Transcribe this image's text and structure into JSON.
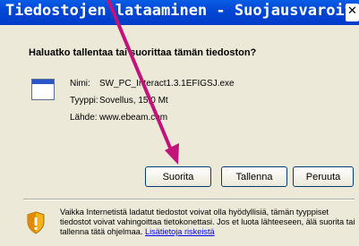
{
  "window": {
    "title": "Tiedostojen lataaminen - Suojausvaroitus"
  },
  "dialog": {
    "question": "Haluatko tallentaa tai suorittaa tämän tiedoston?",
    "fields": [
      {
        "label": "Nimi:",
        "value": "SW_PC_Interact1.3.1EFIGSJ.exe"
      },
      {
        "label": "Tyyppi:",
        "value": "Sovellus, 15,0 Mt"
      },
      {
        "label": "Lähde:",
        "value": "www.ebeam.com"
      }
    ],
    "buttons": {
      "run": "Suorita",
      "save": "Tallenna",
      "cancel": "Peruuta"
    },
    "warning_text": "Vaikka Internetistä ladatut tiedostot voivat olla hyödyllisiä, tämän tyyppiset tiedostot voivat vahingoittaa tietokonettasi. Jos et luota lähteeseen, älä suorita tai tallenna tätä ohjelmaa.",
    "warning_link": "Lisätietoja riskeistä"
  },
  "colors": {
    "titlebar": "#0147d6",
    "annotation_arrow": "#c2137a"
  },
  "icons": [
    "file-window-icon",
    "security-shield-icon",
    "close-icon"
  ]
}
